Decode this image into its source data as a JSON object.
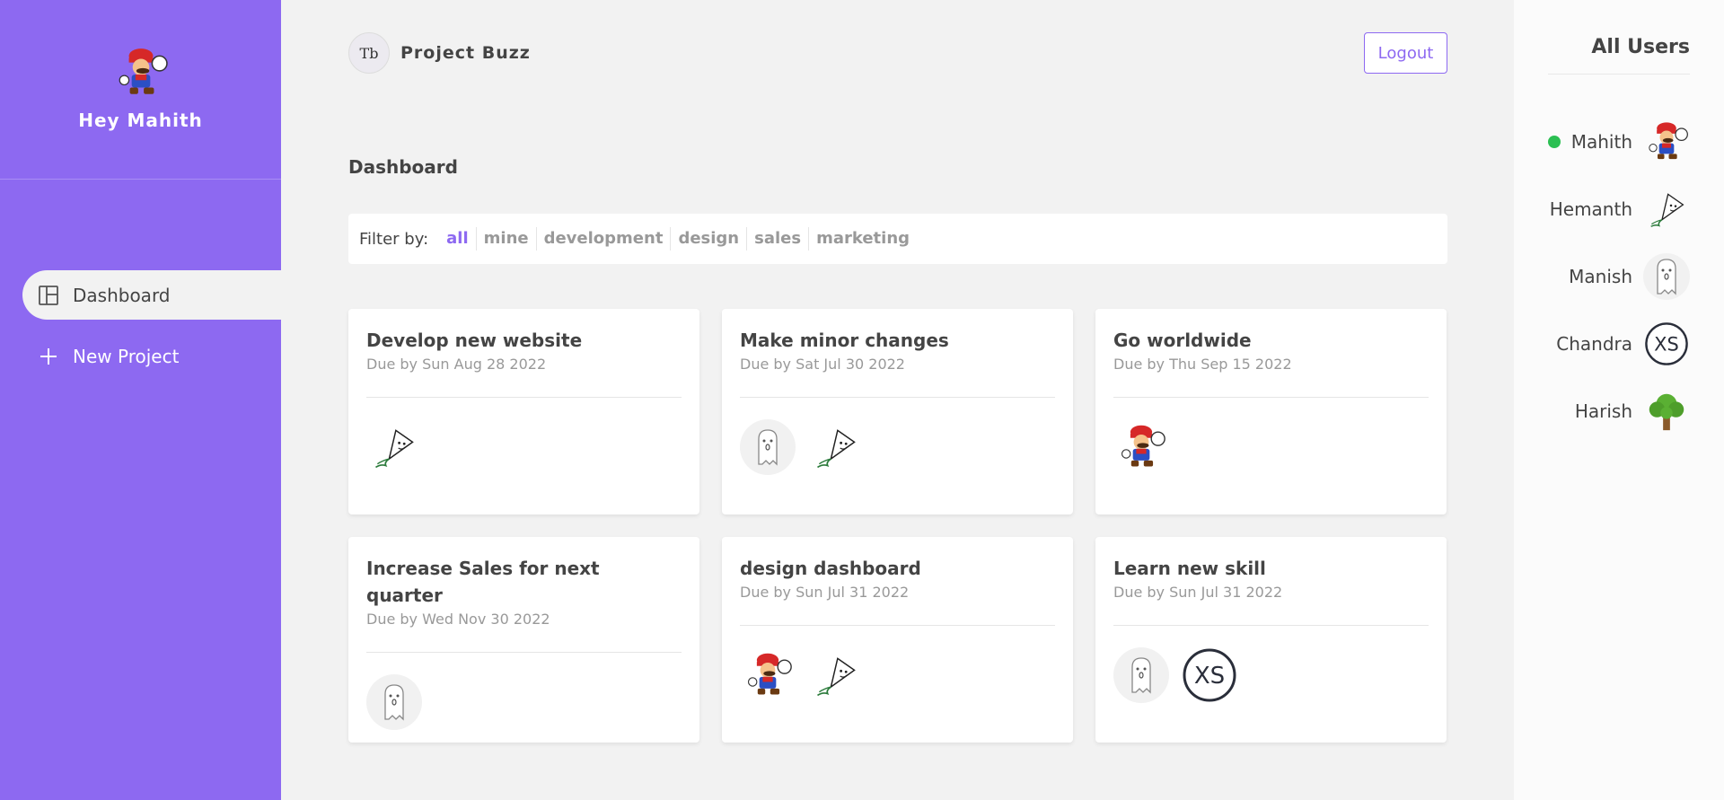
{
  "sidebar": {
    "greeting": "Hey Mahith",
    "avatar_icon": "mario-avatar-icon",
    "nav": [
      {
        "label": "Dashboard",
        "icon": "dashboard-icon",
        "active": true
      },
      {
        "label": "New Project",
        "icon": "plus-icon",
        "active": false
      }
    ]
  },
  "header": {
    "brand": "Project Buzz",
    "logo_text": "Tb",
    "logout_label": "Logout"
  },
  "main": {
    "title": "Dashboard",
    "filter": {
      "label": "Filter by:",
      "options": [
        "all",
        "mine",
        "development",
        "design",
        "sales",
        "marketing"
      ],
      "active": "all"
    },
    "projects": [
      {
        "title": "Develop new website",
        "due": "Due by Sun Aug 28 2022",
        "assignees": [
          "kite"
        ]
      },
      {
        "title": "Make minor changes",
        "due": "Due by Sat Jul 30 2022",
        "assignees": [
          "ghost",
          "kite"
        ]
      },
      {
        "title": "Go worldwide",
        "due": "Due by Thu Sep 15 2022",
        "assignees": [
          "mario"
        ]
      },
      {
        "title": "Increase Sales for next quarter",
        "due": "Due by Wed Nov 30 2022",
        "assignees": [
          "ghost"
        ]
      },
      {
        "title": "design dashboard",
        "due": "Due by Sun Jul 31 2022",
        "assignees": [
          "mario",
          "kite"
        ]
      },
      {
        "title": "Learn new skill",
        "due": "Due by Sun Jul 31 2022",
        "assignees": [
          "ghost",
          "xs"
        ]
      }
    ]
  },
  "users_panel": {
    "title": "All Users",
    "users": [
      {
        "name": "Mahith",
        "online": true,
        "avatar": "mario"
      },
      {
        "name": "Hemanth",
        "online": false,
        "avatar": "kite"
      },
      {
        "name": "Manish",
        "online": false,
        "avatar": "ghost"
      },
      {
        "name": "Chandra",
        "online": false,
        "avatar": "xs"
      },
      {
        "name": "Harish",
        "online": false,
        "avatar": "tree"
      }
    ]
  },
  "colors": {
    "accent": "#8d69f1",
    "background": "#f2f2f2",
    "online": "#2bbf52"
  }
}
